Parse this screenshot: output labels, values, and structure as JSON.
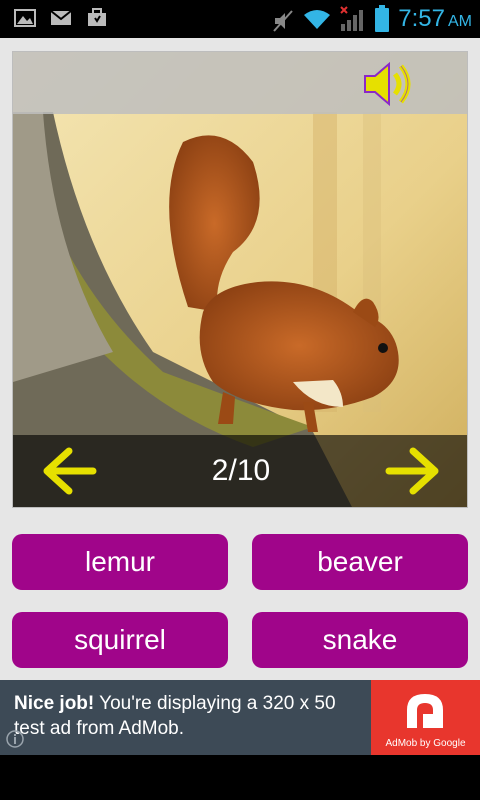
{
  "status_bar": {
    "time": "7:57",
    "ampm": "AM",
    "left_icons": [
      "image-icon",
      "gmail-icon",
      "briefcase-icon"
    ],
    "right_icons": [
      "mute-icon",
      "wifi-icon",
      "signal-icon",
      "battery-icon"
    ],
    "accent_color": "#33b5e5"
  },
  "quiz": {
    "counter": "2/10",
    "sound_icon": "speaker-icon",
    "prev_icon": "arrow-left-icon",
    "next_icon": "arrow-right-icon",
    "arrow_color": "#e6e000",
    "answers": [
      "lemur",
      "beaver",
      "squirrel",
      "snake"
    ],
    "answer_color": "#a0058a"
  },
  "ad": {
    "headline": "Nice job!",
    "body": " You're displaying a 320 x 50 test ad from AdMob.",
    "logo_caption": "AdMob by Google",
    "logo_color": "#e8362d"
  }
}
